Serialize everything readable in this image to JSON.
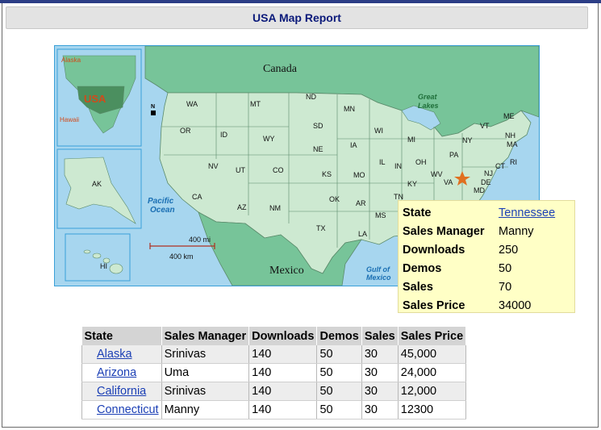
{
  "report": {
    "title": "USA Map Report"
  },
  "map": {
    "labels": {
      "canada": "Canada",
      "mexico": "Mexico",
      "pacific_1": "Pacific",
      "pacific_2": "Ocean",
      "gulf_1": "Gulf of",
      "gulf_2": "Mexico",
      "great_1": "Great",
      "great_2": "Lakes",
      "alaska_inset": "Alaska",
      "hawaii_inset": "Hawaii",
      "usa_inset": "USA",
      "ak": "AK",
      "hi": "HI",
      "north": "N",
      "scale_mi": "400 mi",
      "scale_km": "400 km"
    },
    "states": [
      {
        "abbr": "WA"
      },
      {
        "abbr": "OR"
      },
      {
        "abbr": "CA"
      },
      {
        "abbr": "ID"
      },
      {
        "abbr": "NV"
      },
      {
        "abbr": "MT"
      },
      {
        "abbr": "WY"
      },
      {
        "abbr": "UT"
      },
      {
        "abbr": "AZ"
      },
      {
        "abbr": "CO"
      },
      {
        "abbr": "NM"
      },
      {
        "abbr": "ND"
      },
      {
        "abbr": "SD"
      },
      {
        "abbr": "NE"
      },
      {
        "abbr": "KS"
      },
      {
        "abbr": "OK"
      },
      {
        "abbr": "TX"
      },
      {
        "abbr": "MN"
      },
      {
        "abbr": "IA"
      },
      {
        "abbr": "MO"
      },
      {
        "abbr": "AR"
      },
      {
        "abbr": "LA"
      },
      {
        "abbr": "WI"
      },
      {
        "abbr": "IL"
      },
      {
        "abbr": "MS"
      },
      {
        "abbr": "MI"
      },
      {
        "abbr": "IN"
      },
      {
        "abbr": "OH"
      },
      {
        "abbr": "KY"
      },
      {
        "abbr": "TN"
      },
      {
        "abbr": "WV"
      },
      {
        "abbr": "VA"
      },
      {
        "abbr": "PA"
      },
      {
        "abbr": "NY"
      },
      {
        "abbr": "VT"
      },
      {
        "abbr": "ME"
      },
      {
        "abbr": "NH"
      },
      {
        "abbr": "MA"
      },
      {
        "abbr": "CT"
      },
      {
        "abbr": "RI"
      },
      {
        "abbr": "NJ"
      },
      {
        "abbr": "DE"
      },
      {
        "abbr": "MD"
      }
    ],
    "colors": {
      "water": "#a7d6ef",
      "land": "#cde9d1",
      "foreign": "#77c499",
      "border": "#5a8a6a",
      "marker": "#e07020"
    }
  },
  "tooltip": {
    "rows": [
      {
        "key": "State",
        "value": "Tennessee",
        "link": true
      },
      {
        "key": "Sales Manager",
        "value": "Manny"
      },
      {
        "key": "Downloads",
        "value": "250"
      },
      {
        "key": "Demos",
        "value": "50"
      },
      {
        "key": "Sales",
        "value": "70"
      },
      {
        "key": "Sales Price",
        "value": "34000"
      }
    ]
  },
  "table": {
    "headers": [
      "State",
      "Sales Manager",
      "Downloads",
      "Demos",
      "Sales",
      "Sales Price"
    ],
    "rows": [
      {
        "state": "Alaska",
        "manager": "Srinivas",
        "downloads": "140",
        "demos": "50",
        "sales": "30",
        "price": "45,000"
      },
      {
        "state": "Arizona",
        "manager": "Uma",
        "downloads": "140",
        "demos": "50",
        "sales": "30",
        "price": "24,000"
      },
      {
        "state": "California",
        "manager": "Srinivas",
        "downloads": "140",
        "demos": "50",
        "sales": "30",
        "price": "12,000"
      },
      {
        "state": "Connecticut",
        "manager": "Manny",
        "downloads": "140",
        "demos": "50",
        "sales": "30",
        "price": "12300"
      }
    ]
  }
}
